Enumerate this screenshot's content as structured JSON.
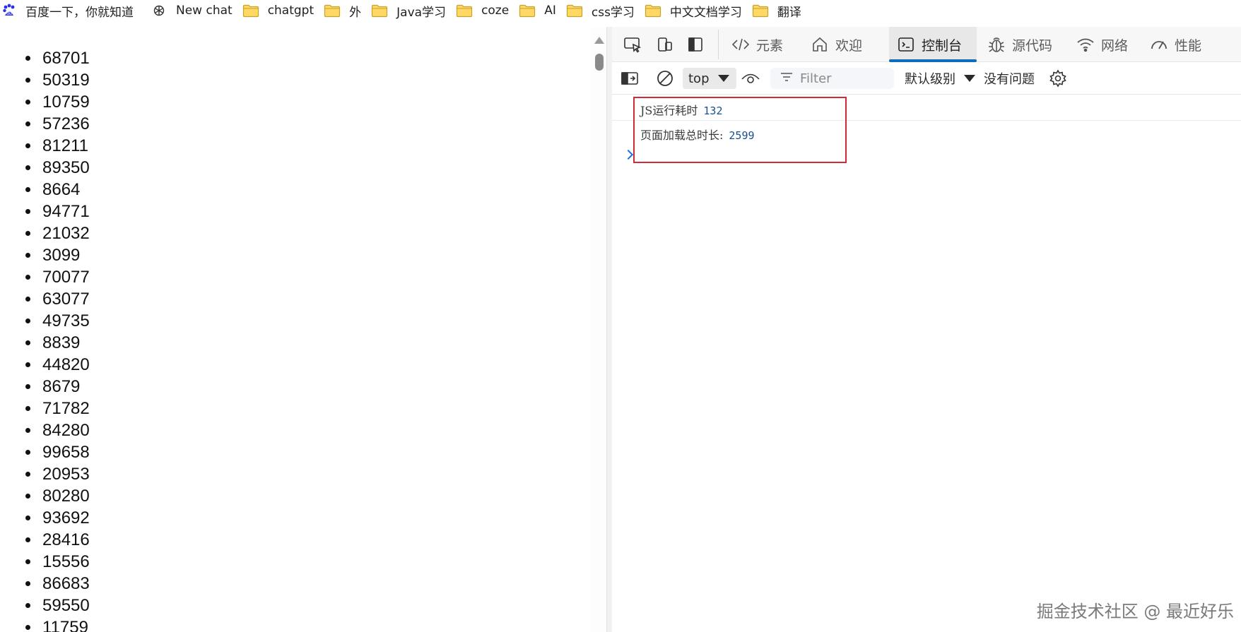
{
  "bookmarks": [
    {
      "label": "百度一下，你就知道",
      "icon": "baidu-icon"
    },
    {
      "label": "New chat",
      "icon": "openai-icon"
    },
    {
      "label": "chatgpt",
      "icon": "folder-icon"
    },
    {
      "label": "外",
      "icon": "folder-icon"
    },
    {
      "label": "Java学习",
      "icon": "folder-icon"
    },
    {
      "label": "coze",
      "icon": "folder-icon"
    },
    {
      "label": "AI",
      "icon": "folder-icon"
    },
    {
      "label": "css学习",
      "icon": "folder-icon"
    },
    {
      "label": "中文文档学习",
      "icon": "folder-icon"
    },
    {
      "label": "翻译",
      "icon": "folder-icon"
    }
  ],
  "page": {
    "numbers": [
      "68701",
      "50319",
      "10759",
      "57236",
      "81211",
      "89350",
      "8664",
      "94771",
      "21032",
      "3099",
      "70077",
      "63077",
      "49735",
      "8839",
      "44820",
      "8679",
      "71782",
      "84280",
      "99658",
      "20953",
      "80280",
      "93692",
      "28416",
      "15556",
      "86683",
      "59550",
      "11759"
    ]
  },
  "devtools": {
    "tabs": [
      {
        "label": "元素",
        "icon": "code-icon",
        "active": false
      },
      {
        "label": "欢迎",
        "icon": "home-icon",
        "active": false
      },
      {
        "label": "控制台",
        "icon": "console-icon",
        "active": true
      },
      {
        "label": "源代码",
        "icon": "bug-icon",
        "active": false
      },
      {
        "label": "网络",
        "icon": "wifi-icon",
        "active": false
      },
      {
        "label": "性能",
        "icon": "gauge-icon",
        "active": false
      }
    ],
    "toolbar": {
      "context": "top",
      "filter_placeholder": "Filter",
      "level": "默认级别",
      "issues": "没有问题"
    },
    "console": {
      "messages": [
        {
          "label": "JS运行耗时",
          "value": "132"
        },
        {
          "label": "页面加载总时长:",
          "value": "2599"
        }
      ]
    },
    "accent_color": "#0f6cbd",
    "highlight_color": "#d22b35"
  },
  "watermark": "掘金技术社区 @ 最近好乐"
}
